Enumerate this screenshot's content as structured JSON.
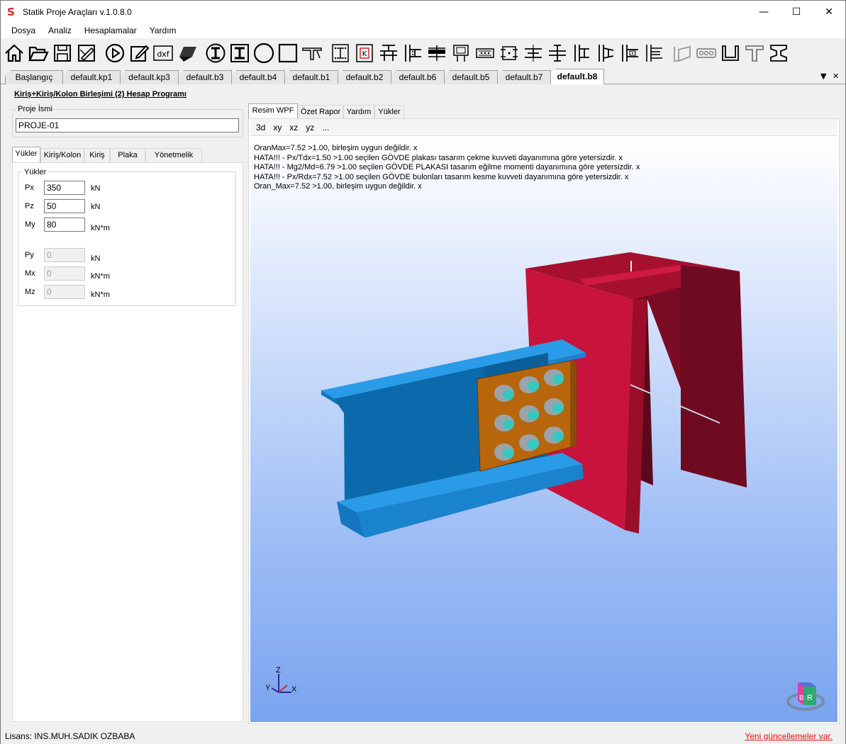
{
  "window": {
    "title": "Statik Proje Araçları v.1.0.8.0",
    "minimize": "—",
    "maximize": "☐",
    "close": "✕"
  },
  "menu": [
    "Dosya",
    "Analiz",
    "Hesaplamalar",
    "Yardım"
  ],
  "toolbar_icons": [
    "home-icon",
    "open-folder-icon",
    "save-icon",
    "save-as-icon",
    "run-icon",
    "edit-icon",
    "dxf-icon",
    "shape-icon",
    "i-section-circle-icon",
    "i-section-square-icon",
    "circle-section-icon",
    "square-section-icon",
    "t-beam-icon",
    "column-base-plate-icon",
    "k-plate-icon",
    "beam-column-icon-1",
    "beam-column-icon-2",
    "beam-splice-icon",
    "plate-icon-1",
    "plate-icon-2",
    "plate-icon-3",
    "beam-beam-icon-1",
    "beam-beam-icon-2",
    "beam-column-icon-3",
    "beam-column-icon-4",
    "beam-column-icon-5",
    "beam-column-icon-6",
    "box-section-icon",
    "bolt-row-icon",
    "channel-icon",
    "tee-icon",
    "h-section-icon"
  ],
  "doc_tabs": {
    "items": [
      "Başlangıç",
      "default.kp1",
      "default.kp3",
      "default.b3",
      "default.b4",
      "default.b1",
      "default.b2",
      "default.b6",
      "default.b5",
      "default.b7",
      "default.b8"
    ],
    "active": "default.b8",
    "dropdown": "▼",
    "close": "✕"
  },
  "left": {
    "program_title": "Kiriş+Kiriş/Kolon Birleşimi (2) Hesap Programı",
    "project_name_label": "Proje İsmi",
    "project_name_value": "PROJE-01",
    "tabs": [
      "Yükler",
      "Kiriş/Kolon",
      "Kiriş",
      "Plaka",
      "Yönetmelik"
    ],
    "active_tab": "Yükler",
    "loads_group_label": "Yükler",
    "loads": [
      {
        "label": "Px",
        "value": "350",
        "unit": "kN",
        "enabled": true
      },
      {
        "label": "Pz",
        "value": "50",
        "unit": "kN",
        "enabled": true
      },
      {
        "label": "My",
        "value": "80",
        "unit": "kN*m",
        "enabled": true
      },
      {
        "label": "Py",
        "value": "0",
        "unit": "kN",
        "enabled": false
      },
      {
        "label": "Mx",
        "value": "0",
        "unit": "kN*m",
        "enabled": false
      },
      {
        "label": "Mz",
        "value": "0",
        "unit": "kN*m",
        "enabled": false
      }
    ]
  },
  "right": {
    "tabs": [
      "Resim WPF",
      "Özet Rapor",
      "Yardım",
      "Yükler"
    ],
    "active_tab": "Resim WPF",
    "view_buttons": [
      "3d",
      "xy",
      "xz",
      "yz",
      "..."
    ],
    "messages": [
      "OranMax=7.52 >1.00, birleşim uygun değildir. x",
      "HATA!!! - Px/Tdx=1.50 >1.00 seçilen GÖVDE plakası tasarım çekme kuvveti dayanımına göre yetersizdir. x",
      "HATA!!! - Mg2/Md=6.79 >1.00 seçilen GÖVDE PLAKASI tasarım eğilme momenti dayanımına göre yetersizdir. x",
      "HATA!!! - Px/Rdx=7.52 >1.00 seçilen GÖVDE bulonları tasarım kesme kuvveti dayanımına göre yetersizdir. x",
      "Oran_Max=7.52 >1.00, birleşim uygun değildir. x"
    ],
    "axes": {
      "z": "Z",
      "y": "Y",
      "x": "X"
    },
    "cube_faces": {
      "b": "B",
      "r": "R"
    },
    "colors": {
      "column": "#c8143c",
      "beam": "#1c8ad8",
      "plate": "#b8660c",
      "bolt": "#36c8c0"
    }
  },
  "status": {
    "license": "Lisans: INS.MUH.SADIK OZBABA",
    "update": "Yeni güncellemeler var."
  }
}
